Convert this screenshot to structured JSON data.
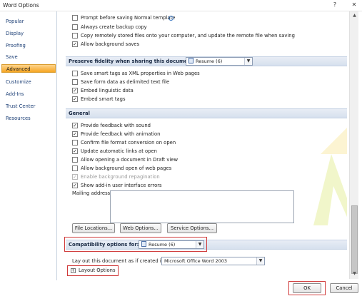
{
  "window": {
    "title": "Word Options",
    "help_glyph": "?",
    "close_glyph": "✕"
  },
  "sidebar": {
    "items": [
      {
        "label": "Popular"
      },
      {
        "label": "Display"
      },
      {
        "label": "Proofing"
      },
      {
        "label": "Save"
      },
      {
        "label": "Advanced",
        "active": true
      },
      {
        "label": "Customize"
      },
      {
        "label": "Add-Ins"
      },
      {
        "label": "Trust Center"
      },
      {
        "label": "Resources"
      }
    ]
  },
  "top_options": [
    {
      "label": "Prompt before saving Normal template",
      "checked": false
    },
    {
      "label": "Always create backup copy",
      "checked": false
    },
    {
      "label": "Copy remotely stored files onto your computer, and update the remote file when saving",
      "checked": false
    },
    {
      "label": "Allow background saves",
      "checked": true
    }
  ],
  "fidelity": {
    "header": "Preserve fidelity when sharing this document:",
    "document": "Resume (6)",
    "options": [
      {
        "label": "Save smart tags as XML properties in Web pages",
        "checked": false
      },
      {
        "label": "Save form data as delimited text file",
        "checked": false
      },
      {
        "label": "Embed linguistic data",
        "checked": true
      },
      {
        "label": "Embed smart tags",
        "checked": true
      }
    ]
  },
  "general": {
    "header": "General",
    "options": [
      {
        "label": "Provide feedback with sound",
        "checked": true,
        "disabled": false
      },
      {
        "label": "Provide feedback with animation",
        "checked": true,
        "disabled": false
      },
      {
        "label": "Confirm file format conversion on open",
        "checked": false,
        "disabled": false
      },
      {
        "label": "Update automatic links at open",
        "checked": true,
        "disabled": false
      },
      {
        "label": "Allow opening a document in Draft view",
        "checked": false,
        "disabled": false
      },
      {
        "label": "Allow background open of web pages",
        "checked": false,
        "disabled": false
      },
      {
        "label": "Enable background repagination",
        "checked": true,
        "disabled": true
      },
      {
        "label": "Show add-in user interface errors",
        "checked": true,
        "disabled": false
      }
    ],
    "mailing_address_label": "Mailing address:",
    "buttons": {
      "file_locations": "File Locations...",
      "web_options": "Web Options...",
      "service_options": "Service Options..."
    }
  },
  "compatibility": {
    "header": "Compatibility options for:",
    "document": "Resume (6)",
    "layout_label": "Lay out this document as if created in:",
    "layout_value": "Microsoft Office Word 2003",
    "layout_options_label": "Layout Options",
    "expand_glyph": "+"
  },
  "footer": {
    "ok_label": "OK",
    "cancel_label": "Cancel"
  },
  "colors": {
    "active_nav": "#f7a623",
    "section_header": "#d6e0ee",
    "highlight": "#d03a3a"
  }
}
